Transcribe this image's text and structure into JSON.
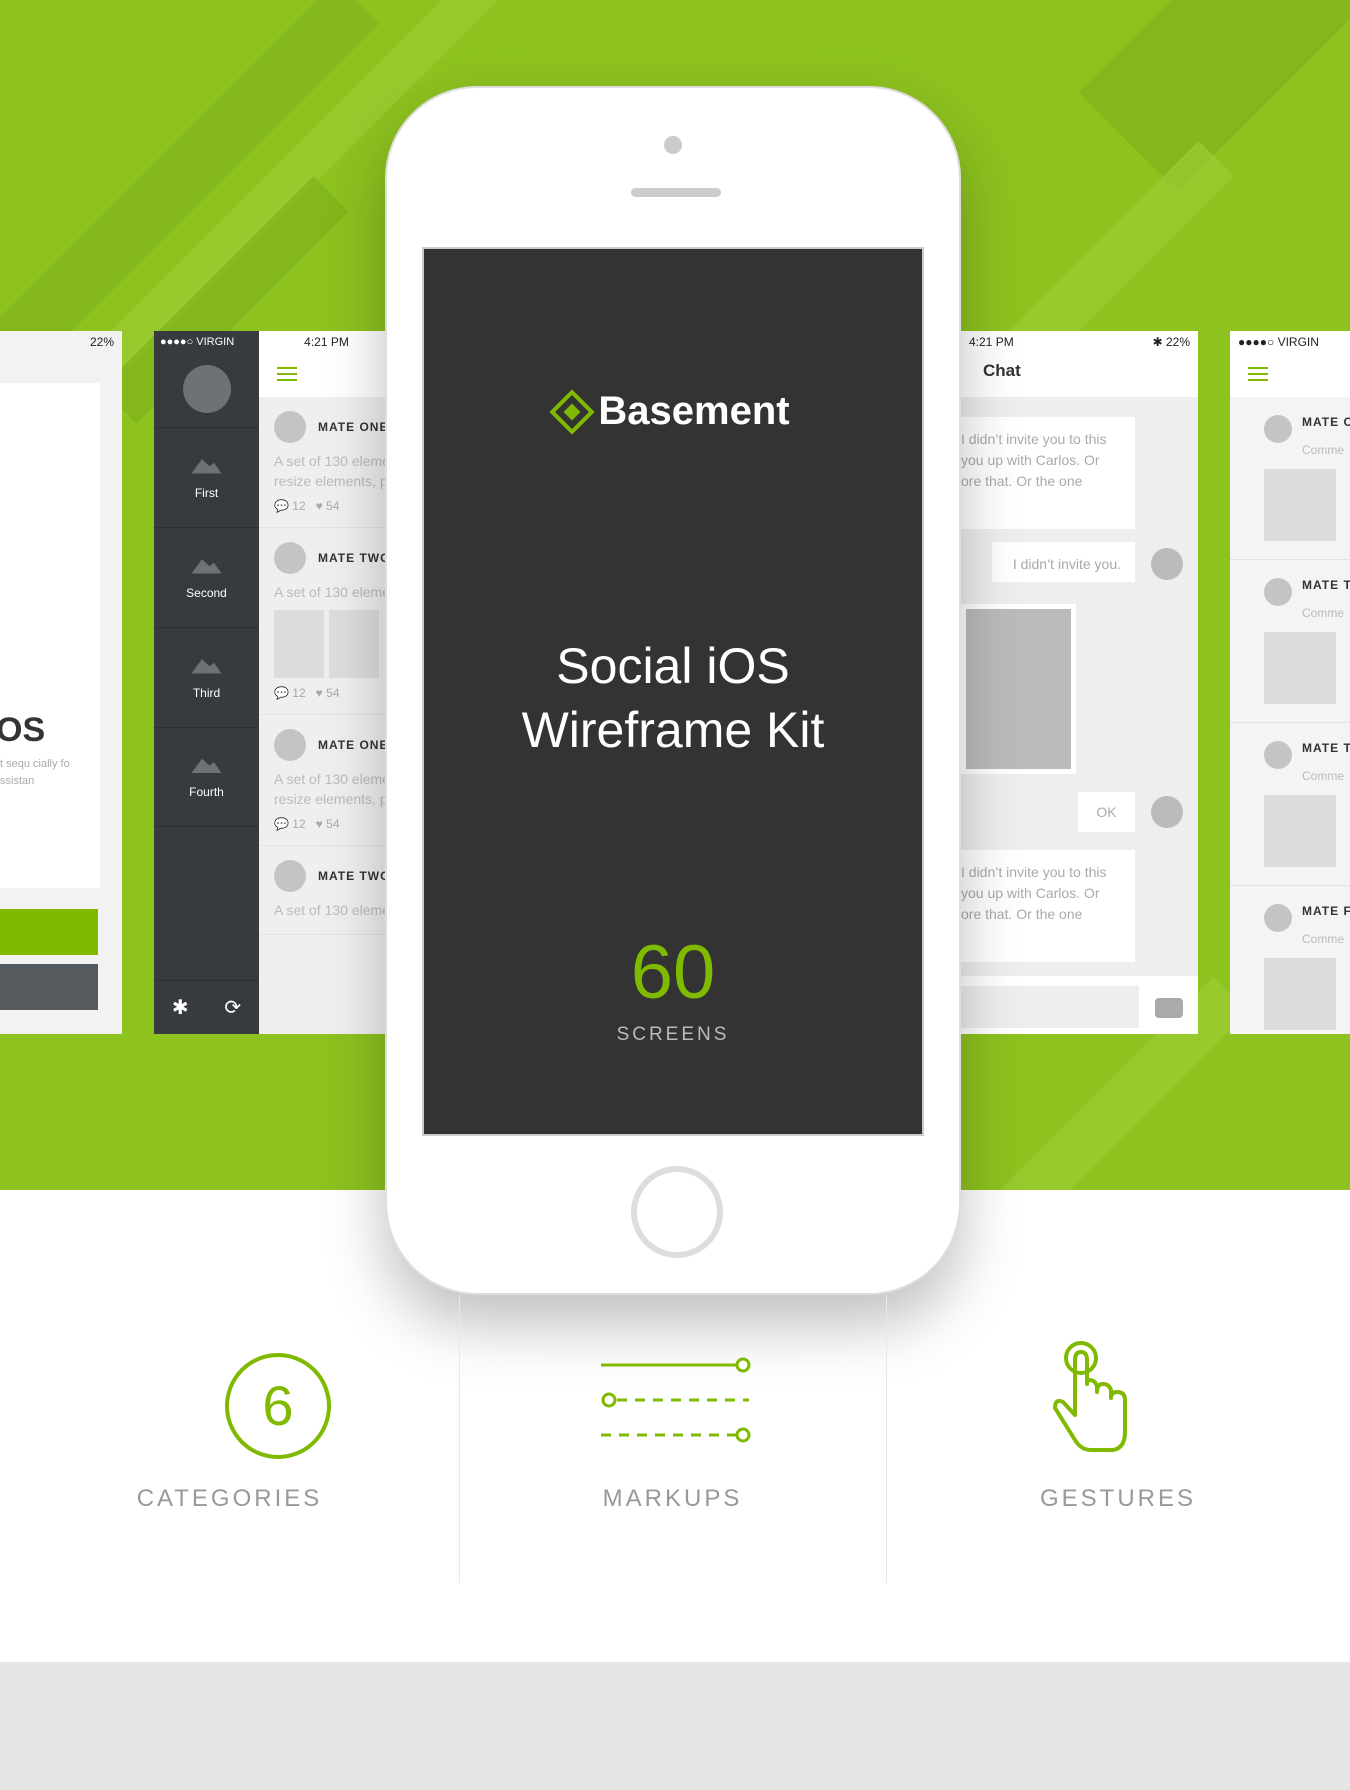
{
  "colors": {
    "accent": "#7fba00",
    "background": "#8dc21f",
    "screen": "#333333"
  },
  "left_panel": {
    "status": "22%",
    "heading": "OS",
    "text": "t sequ cially fo ssistan"
  },
  "sidebar_app": {
    "carrier": "●●●●○ VIRGIN",
    "time": "4:21 PM",
    "menu": [
      {
        "label": "First",
        "icon": "mountain-icon"
      },
      {
        "label": "Second",
        "icon": "mountain-icon"
      },
      {
        "label": "Third",
        "icon": "mountain-icon"
      },
      {
        "label": "Fourth",
        "icon": "mountain-icon"
      }
    ],
    "footer_icons": [
      "gear-icon",
      "logout-icon"
    ],
    "posts": [
      {
        "name": "MATE ONE",
        "text": "A set of 130 elements. Click, drag, resize elements, perfect",
        "comments": "12",
        "likes": "54"
      },
      {
        "name": "MATE TWO",
        "text": "A set of 130 elements",
        "comments": "12",
        "likes": "54"
      },
      {
        "name": "MATE ONE",
        "text": "A set of 130 elements. Click, drag, resize elements, perfect",
        "comments": "12",
        "likes": "54"
      },
      {
        "name": "MATE TWO",
        "text": "A set of 130 elements"
      }
    ]
  },
  "phone": {
    "brand": "Basement",
    "title_line1": "Social iOS",
    "title_line2": "Wireframe Kit",
    "count": "60",
    "count_label": "SCREENS"
  },
  "chat": {
    "time": "4:21 PM",
    "battery": "✱ 22%",
    "title": "Chat",
    "messages": [
      "I didn’t invite you to this you up with Carlos. Or ore that. Or the one",
      "I didn’t invite you.",
      "OK",
      "I didn’t invite you to this you up with Carlos. Or ore that. Or the one"
    ]
  },
  "right_panel": {
    "carrier": "●●●●○ VIRGIN",
    "posts": [
      {
        "name": "MATE O",
        "sub": "Comme"
      },
      {
        "name": "MATE T",
        "sub": "Comme"
      },
      {
        "name": "MATE T",
        "sub": "Comme"
      },
      {
        "name": "MATE F",
        "sub": "Comme"
      }
    ]
  },
  "features": [
    {
      "value": "6",
      "label": "CATEGORIES"
    },
    {
      "label": "MARKUPS",
      "icon": "markup-lines-icon"
    },
    {
      "label": "GESTURES",
      "icon": "tap-hand-icon"
    }
  ]
}
